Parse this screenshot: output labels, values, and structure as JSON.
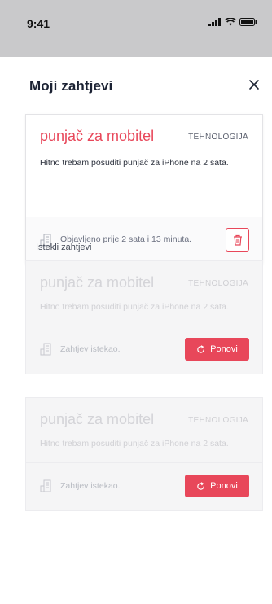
{
  "status_bar": {
    "time": "9:41"
  },
  "modal": {
    "title": "Moji zahtjevi"
  },
  "active_request": {
    "title": "punjač za mobitel",
    "category": "TEHNOLOGIJA",
    "description": "Hitno trebam posuditi punjač za iPhone na 2 sata.",
    "posted": "Objavljeno prije 2 sata i 13 minuta."
  },
  "expired_section": {
    "label": "Istekli zahtjevi"
  },
  "expired_requests": [
    {
      "title": "punjač za mobitel",
      "category": "TEHNOLOGIJA",
      "description": "Hitno trebam posuditi punjač za iPhone na 2 sata.",
      "status": "Zahtjev istekao.",
      "button_label": "Ponovi"
    },
    {
      "title": "punjač za mobitel",
      "category": "TEHNOLOGIJA",
      "description": "Hitno trebam posuditi punjač za iPhone na 2 sata.",
      "status": "Zahtjev istekao.",
      "button_label": "Ponovi"
    }
  ],
  "colors": {
    "accent": "#e8475a",
    "title": "#1b2233",
    "status_bar": "#c9c9cb"
  }
}
